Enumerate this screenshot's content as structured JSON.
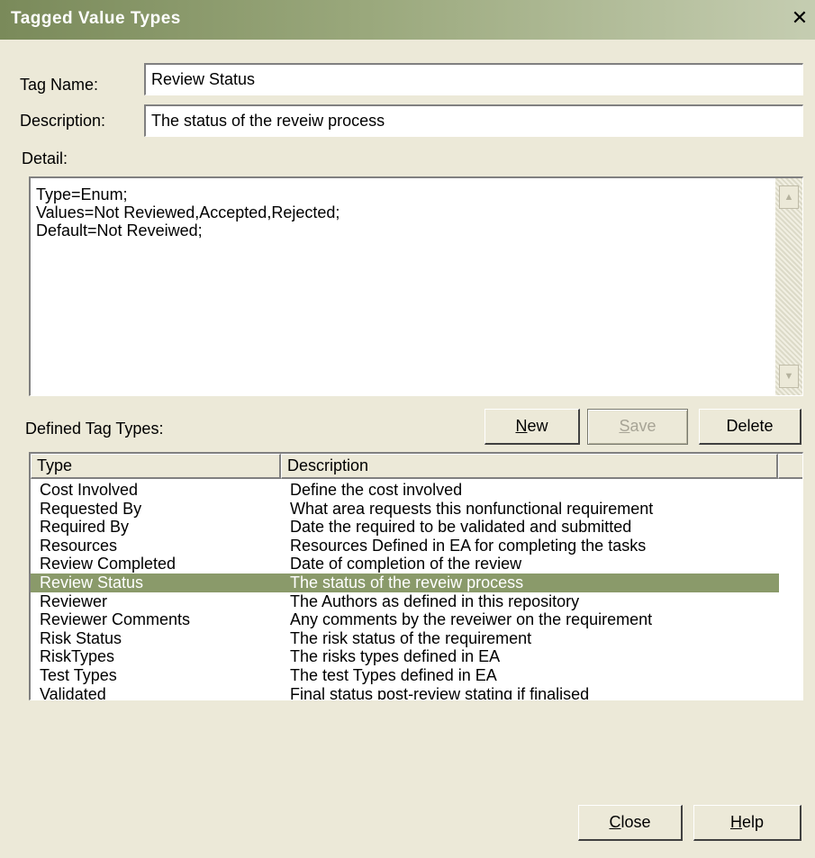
{
  "window": {
    "title": "Tagged Value Types",
    "close_glyph": "✕"
  },
  "form": {
    "tag_name_label": "Tag Name:",
    "tag_name_value": "Review Status",
    "description_label": "Description:",
    "description_value": "The status of the reveiw process",
    "detail_label": "Detail:",
    "detail_value": "Type=Enum;\nValues=Not Reviewed,Accepted,Rejected;\nDefault=Not Reveiwed;"
  },
  "defined": {
    "label": "Defined Tag Types:",
    "buttons": {
      "new": "N",
      "new_rest": "ew",
      "save": "S",
      "save_rest": "ave",
      "delete": "Delete"
    },
    "columns": [
      "Type",
      "Description"
    ],
    "selected_index": 5,
    "rows": [
      {
        "type": "Cost Involved",
        "description": "Define the cost involved"
      },
      {
        "type": "Requested By",
        "description": "What area requests this nonfunctional requirement"
      },
      {
        "type": "Required By",
        "description": "Date the required to be validated and submitted"
      },
      {
        "type": "Resources",
        "description": "Resources Defined in EA for completing the tasks"
      },
      {
        "type": "Review Completed",
        "description": "Date of completion of the review"
      },
      {
        "type": "Review Status",
        "description": "The status of the reveiw process"
      },
      {
        "type": "Reviewer",
        "description": "The Authors as defined in this repository"
      },
      {
        "type": "Reviewer Comments",
        "description": "Any comments by the reveiwer on the requirement"
      },
      {
        "type": "Risk Status",
        "description": "The risk status of the requirement"
      },
      {
        "type": "RiskTypes",
        "description": "The risks types defined in EA"
      },
      {
        "type": "Test Types",
        "description": "The test Types defined in EA"
      },
      {
        "type": "Validated",
        "description": "Final status post-review stating if finalised"
      }
    ]
  },
  "footer": {
    "close": "C",
    "close_rest": "lose",
    "help": "H",
    "help_rest": "elp"
  },
  "colors": {
    "title_bar": "#7a8a5a",
    "selection": "#8a9a6a",
    "dialog_bg": "#ece9d8"
  },
  "icons": {
    "scroll_up": "scroll-up-arrow-icon",
    "scroll_down": "scroll-down-arrow-icon"
  }
}
